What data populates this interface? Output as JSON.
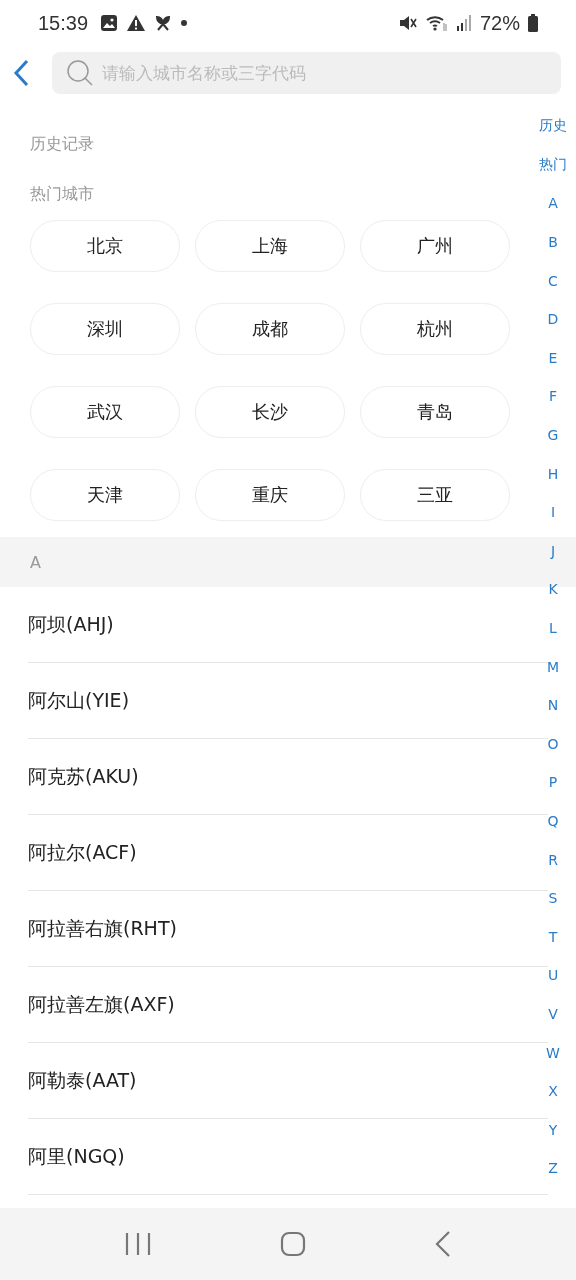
{
  "status_bar": {
    "time": "15:39",
    "battery": "72%"
  },
  "search": {
    "placeholder": "请输入城市名称或三字代码"
  },
  "history": {
    "title": "历史记录"
  },
  "hot": {
    "title": "热门城市",
    "cities": [
      "北京",
      "上海",
      "广州",
      "深圳",
      "成都",
      "杭州",
      "武汉",
      "长沙",
      "青岛",
      "天津",
      "重庆",
      "三亚"
    ]
  },
  "sections": [
    {
      "letter": "A",
      "cities": [
        "阿坝(AHJ)",
        "阿尔山(YIE)",
        "阿克苏(AKU)",
        "阿拉尔(ACF)",
        "阿拉善右旗(RHT)",
        "阿拉善左旗(AXF)",
        "阿勒泰(AAT)",
        "阿里(NGQ)"
      ]
    }
  ],
  "index": [
    "历史",
    "热门",
    "A",
    "B",
    "C",
    "D",
    "E",
    "F",
    "G",
    "H",
    "I",
    "J",
    "K",
    "L",
    "M",
    "N",
    "O",
    "P",
    "Q",
    "R",
    "S",
    "T",
    "U",
    "V",
    "W",
    "X",
    "Y",
    "Z"
  ]
}
